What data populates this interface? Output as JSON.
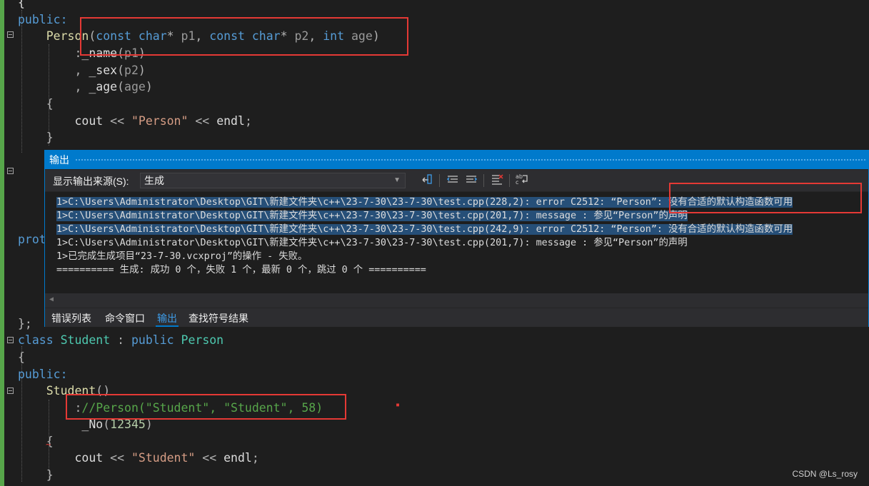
{
  "editor": {
    "code_lines": [
      {
        "text": "{"
      },
      {
        "text": "public:"
      },
      {
        "text": "    Person(const char* p1, const char* p2, int age)"
      },
      {
        "text": "        :_name(p1)"
      },
      {
        "text": "        , _sex(p2)"
      },
      {
        "text": "        , _age(age)"
      },
      {
        "text": "    {"
      },
      {
        "text": "        cout << \"Person\" << endl;"
      },
      {
        "text": "    }"
      },
      {
        "text": "prot"
      },
      {
        "text": "};"
      },
      {
        "text": "class Student : public Person"
      },
      {
        "text": "{"
      },
      {
        "text": "public:"
      },
      {
        "text": "    Student()"
      },
      {
        "text": "        ://Person(\"Student\", \"Student\", 58)"
      },
      {
        "text": "         _No(12345)"
      },
      {
        "text": "    {"
      },
      {
        "text": "        cout << \"Student\" << endl;"
      },
      {
        "text": "    }"
      }
    ]
  },
  "output_panel": {
    "title": "输出",
    "source_label": "显示输出来源(S):",
    "source_value": "生成",
    "toolbar_icons": [
      "clear-all-icon",
      "go-to-previous-icon",
      "go-to-next-icon",
      "clear-output-icon",
      "word-wrap-icon"
    ],
    "lines": [
      "1>C:\\Users\\Administrator\\Desktop\\GIT\\新建文件夹\\c++\\23-7-30\\23-7-30\\test.cpp(228,2): error C2512: “Person”: 没有合适的默认构造函数可用",
      "1>C:\\Users\\Administrator\\Desktop\\GIT\\新建文件夹\\c++\\23-7-30\\23-7-30\\test.cpp(201,7): message : 参见“Person”的声明",
      "1>C:\\Users\\Administrator\\Desktop\\GIT\\新建文件夹\\c++\\23-7-30\\23-7-30\\test.cpp(242,9): error C2512: “Person”: 没有合适的默认构造函数可用",
      "1>C:\\Users\\Administrator\\Desktop\\GIT\\新建文件夹\\c++\\23-7-30\\23-7-30\\test.cpp(201,7): message : 参见“Person”的声明",
      "1>已完成生成项目“23-7-30.vcxproj”的操作 - 失败。",
      "========== 生成: 成功 0 个，失败 1 个，最新 0 个，跳过 0 个 =========="
    ],
    "tabs": [
      "错误列表",
      "命令窗口",
      "输出",
      "查找符号结果"
    ],
    "active_tab": "输出"
  },
  "watermark": "CSDN @Ls_rosy",
  "colors": {
    "accent": "#007acc",
    "annotation_box": "#e53935",
    "editor_bg": "#1e1e1e",
    "selection": "#264f78"
  }
}
